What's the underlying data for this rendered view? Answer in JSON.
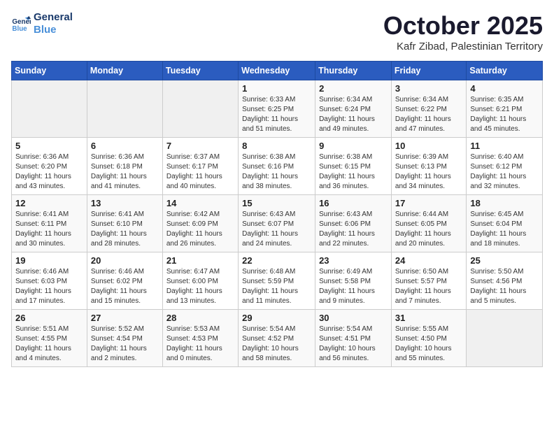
{
  "logo": {
    "line1": "General",
    "line2": "Blue"
  },
  "title": "October 2025",
  "location": "Kafr Zibad, Palestinian Territory",
  "weekdays": [
    "Sunday",
    "Monday",
    "Tuesday",
    "Wednesday",
    "Thursday",
    "Friday",
    "Saturday"
  ],
  "weeks": [
    [
      {
        "day": "",
        "info": ""
      },
      {
        "day": "",
        "info": ""
      },
      {
        "day": "",
        "info": ""
      },
      {
        "day": "1",
        "info": "Sunrise: 6:33 AM\nSunset: 6:25 PM\nDaylight: 11 hours\nand 51 minutes."
      },
      {
        "day": "2",
        "info": "Sunrise: 6:34 AM\nSunset: 6:24 PM\nDaylight: 11 hours\nand 49 minutes."
      },
      {
        "day": "3",
        "info": "Sunrise: 6:34 AM\nSunset: 6:22 PM\nDaylight: 11 hours\nand 47 minutes."
      },
      {
        "day": "4",
        "info": "Sunrise: 6:35 AM\nSunset: 6:21 PM\nDaylight: 11 hours\nand 45 minutes."
      }
    ],
    [
      {
        "day": "5",
        "info": "Sunrise: 6:36 AM\nSunset: 6:20 PM\nDaylight: 11 hours\nand 43 minutes."
      },
      {
        "day": "6",
        "info": "Sunrise: 6:36 AM\nSunset: 6:18 PM\nDaylight: 11 hours\nand 41 minutes."
      },
      {
        "day": "7",
        "info": "Sunrise: 6:37 AM\nSunset: 6:17 PM\nDaylight: 11 hours\nand 40 minutes."
      },
      {
        "day": "8",
        "info": "Sunrise: 6:38 AM\nSunset: 6:16 PM\nDaylight: 11 hours\nand 38 minutes."
      },
      {
        "day": "9",
        "info": "Sunrise: 6:38 AM\nSunset: 6:15 PM\nDaylight: 11 hours\nand 36 minutes."
      },
      {
        "day": "10",
        "info": "Sunrise: 6:39 AM\nSunset: 6:13 PM\nDaylight: 11 hours\nand 34 minutes."
      },
      {
        "day": "11",
        "info": "Sunrise: 6:40 AM\nSunset: 6:12 PM\nDaylight: 11 hours\nand 32 minutes."
      }
    ],
    [
      {
        "day": "12",
        "info": "Sunrise: 6:41 AM\nSunset: 6:11 PM\nDaylight: 11 hours\nand 30 minutes."
      },
      {
        "day": "13",
        "info": "Sunrise: 6:41 AM\nSunset: 6:10 PM\nDaylight: 11 hours\nand 28 minutes."
      },
      {
        "day": "14",
        "info": "Sunrise: 6:42 AM\nSunset: 6:09 PM\nDaylight: 11 hours\nand 26 minutes."
      },
      {
        "day": "15",
        "info": "Sunrise: 6:43 AM\nSunset: 6:07 PM\nDaylight: 11 hours\nand 24 minutes."
      },
      {
        "day": "16",
        "info": "Sunrise: 6:43 AM\nSunset: 6:06 PM\nDaylight: 11 hours\nand 22 minutes."
      },
      {
        "day": "17",
        "info": "Sunrise: 6:44 AM\nSunset: 6:05 PM\nDaylight: 11 hours\nand 20 minutes."
      },
      {
        "day": "18",
        "info": "Sunrise: 6:45 AM\nSunset: 6:04 PM\nDaylight: 11 hours\nand 18 minutes."
      }
    ],
    [
      {
        "day": "19",
        "info": "Sunrise: 6:46 AM\nSunset: 6:03 PM\nDaylight: 11 hours\nand 17 minutes."
      },
      {
        "day": "20",
        "info": "Sunrise: 6:46 AM\nSunset: 6:02 PM\nDaylight: 11 hours\nand 15 minutes."
      },
      {
        "day": "21",
        "info": "Sunrise: 6:47 AM\nSunset: 6:00 PM\nDaylight: 11 hours\nand 13 minutes."
      },
      {
        "day": "22",
        "info": "Sunrise: 6:48 AM\nSunset: 5:59 PM\nDaylight: 11 hours\nand 11 minutes."
      },
      {
        "day": "23",
        "info": "Sunrise: 6:49 AM\nSunset: 5:58 PM\nDaylight: 11 hours\nand 9 minutes."
      },
      {
        "day": "24",
        "info": "Sunrise: 6:50 AM\nSunset: 5:57 PM\nDaylight: 11 hours\nand 7 minutes."
      },
      {
        "day": "25",
        "info": "Sunrise: 5:50 AM\nSunset: 4:56 PM\nDaylight: 11 hours\nand 5 minutes."
      }
    ],
    [
      {
        "day": "26",
        "info": "Sunrise: 5:51 AM\nSunset: 4:55 PM\nDaylight: 11 hours\nand 4 minutes."
      },
      {
        "day": "27",
        "info": "Sunrise: 5:52 AM\nSunset: 4:54 PM\nDaylight: 11 hours\nand 2 minutes."
      },
      {
        "day": "28",
        "info": "Sunrise: 5:53 AM\nSunset: 4:53 PM\nDaylight: 11 hours\nand 0 minutes."
      },
      {
        "day": "29",
        "info": "Sunrise: 5:54 AM\nSunset: 4:52 PM\nDaylight: 10 hours\nand 58 minutes."
      },
      {
        "day": "30",
        "info": "Sunrise: 5:54 AM\nSunset: 4:51 PM\nDaylight: 10 hours\nand 56 minutes."
      },
      {
        "day": "31",
        "info": "Sunrise: 5:55 AM\nSunset: 4:50 PM\nDaylight: 10 hours\nand 55 minutes."
      },
      {
        "day": "",
        "info": ""
      }
    ]
  ]
}
